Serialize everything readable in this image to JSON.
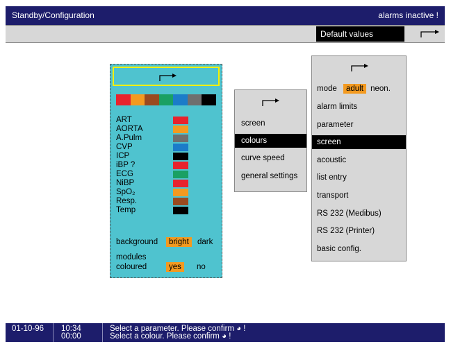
{
  "title": "Standby/Configuration",
  "alarm_status": "alarms inactive !",
  "subbar": {
    "default_values": "Default values",
    "arrow_icon": "right-bent-arrow"
  },
  "colour_panel": {
    "palette": [
      "#e8222d",
      "#f39a20",
      "#9a4a1f",
      "#1aa063",
      "#1b7cc9",
      "#6f6f6f",
      "#000000"
    ],
    "params": [
      {
        "label": "ART",
        "color": "#e8222d"
      },
      {
        "label": "AORTA",
        "color": "#f39a20"
      },
      {
        "label": "A.Pulm",
        "color": "#6f6f6f"
      },
      {
        "label": "CVP",
        "color": "#1b7cc9"
      },
      {
        "label": "ICP",
        "color": "#000000"
      },
      {
        "label": "iBP ?",
        "color": "#e8222d"
      },
      {
        "label": "ECG",
        "color": "#1aa063"
      },
      {
        "label": "NiBP",
        "color": "#e8222d"
      },
      {
        "label": "SpO₂",
        "color": "#f39a20"
      },
      {
        "label": "Resp.",
        "color": "#9a4a1f"
      },
      {
        "label": "Temp",
        "color": "#000000"
      }
    ],
    "background_label": "background",
    "bright": "bright",
    "dark": "dark",
    "modules_label": "modules",
    "coloured_label": "coloured",
    "yes": "yes",
    "no": "no"
  },
  "mid_menu": {
    "items": [
      "screen",
      "colours",
      "curve speed",
      "general settings"
    ],
    "selected": "colours"
  },
  "right_menu": {
    "mode_label": "mode",
    "adult": "adult",
    "neon": "neon.",
    "items": [
      "alarm limits",
      "parameter",
      "screen",
      "acoustic",
      "list entry",
      "transport",
      "RS 232 (Medibus)",
      "RS 232 (Printer)",
      "basic config."
    ],
    "selected": "screen"
  },
  "status": {
    "date": "01-10-96",
    "time": "10:34",
    "elapsed": "00:00",
    "msg1": "Select a parameter. Please confirm ◕ !",
    "msg2": "Select a colour. Please confirm ◕ !"
  }
}
